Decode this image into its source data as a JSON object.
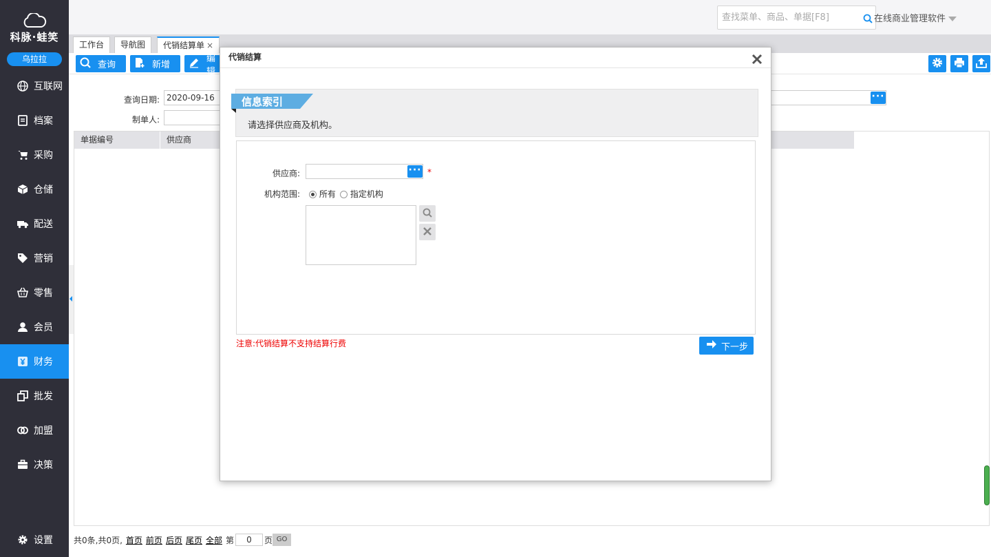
{
  "sidebar": {
    "logo_text": "科脉·蛙笑",
    "user": "乌拉拉",
    "items": [
      {
        "label": "互联网",
        "icon": "globe-icon"
      },
      {
        "label": "档案",
        "icon": "file-icon"
      },
      {
        "label": "采购",
        "icon": "cart-icon"
      },
      {
        "label": "仓储",
        "icon": "box-icon"
      },
      {
        "label": "配送",
        "icon": "truck-icon"
      },
      {
        "label": "营销",
        "icon": "tag-icon"
      },
      {
        "label": "零售",
        "icon": "basket-icon"
      },
      {
        "label": "会员",
        "icon": "user-icon"
      },
      {
        "label": "财务",
        "icon": "yen-icon",
        "active": true
      },
      {
        "label": "批发",
        "icon": "copy-icon"
      },
      {
        "label": "加盟",
        "icon": "rings-icon"
      },
      {
        "label": "决策",
        "icon": "briefcase-icon"
      }
    ],
    "settings_label": "设置"
  },
  "header": {
    "search_placeholder": "查找菜单、商品、单据[F8]",
    "product_name": "在线商业管理软件"
  },
  "tabs": [
    {
      "label": "工作台"
    },
    {
      "label": "导航图"
    },
    {
      "label": "代销结算单",
      "active": true,
      "close": "×"
    }
  ],
  "toolbar": {
    "query_label": "查询",
    "add_label": "新增",
    "edit_label": "编辑"
  },
  "filters": {
    "date_label": "查询日期:",
    "date_value": "2020-09-16",
    "creator_label": "制单人:",
    "dots": "···"
  },
  "grid": {
    "columns": [
      "单据编号",
      "供应商"
    ]
  },
  "pager": {
    "summary": "共0条,共0页,",
    "first": "首页",
    "prev": "前页",
    "next": "后页",
    "last": "尾页",
    "all": "全部",
    "page_prefix": "第",
    "page_value": "0",
    "page_suffix": "页",
    "go": "GO"
  },
  "modal": {
    "title": "代销结算",
    "ribbon": "信息索引",
    "description": "请选择供应商及机构。",
    "supplier_label": "供应商:",
    "required_mark": "*",
    "dots": "···",
    "org_label": "机构范围:",
    "radio_all": "所有",
    "radio_specific": "指定机构",
    "note": "注意:代销结算不支持结算行费",
    "next_label": "下一步"
  },
  "colors": {
    "accent": "#1890f0",
    "sidebar_bg": "#2f2f39",
    "warning": "#e00000"
  }
}
